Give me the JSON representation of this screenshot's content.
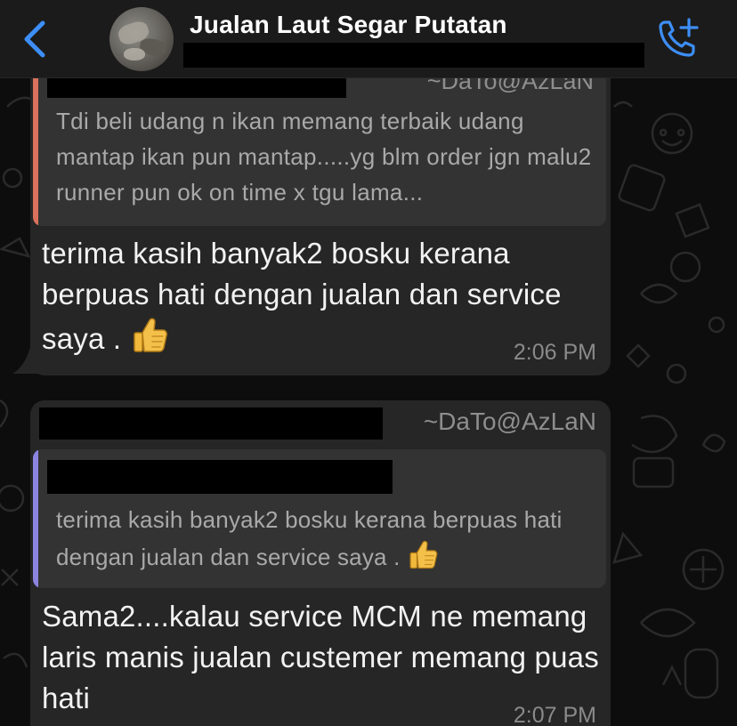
{
  "header": {
    "back_icon": "chevron-left-icon",
    "contact_name": "Jualan Laut Segar Putatan",
    "call_icon": "add-call-icon",
    "accent_color": "#3d8ef7"
  },
  "messages": [
    {
      "quoted": {
        "author": "~DaTo@AzLaN",
        "text": "Tdi beli udang n ikan memang terbaik udang mantap ikan pun mantap.....yg blm order jgn malu2 runner pun ok on time x tgu lama...",
        "bar_color": "#d9715d"
      },
      "text": "terima kasih banyak2 bosku kerana berpuas hati dengan jualan dan service saya . ",
      "emoji": "thumbs-up-icon",
      "time": "2:06 PM"
    },
    {
      "sender": "~DaTo@AzLaN",
      "quoted": {
        "text": "terima kasih banyak2 bosku kerana berpuas hati dengan jualan dan service saya . ",
        "bar_color": "#8c85e0"
      },
      "text": "Sama2....kalau service MCM ne memang laris manis jualan custemer memang puas hati",
      "time": "2:07 PM"
    }
  ]
}
